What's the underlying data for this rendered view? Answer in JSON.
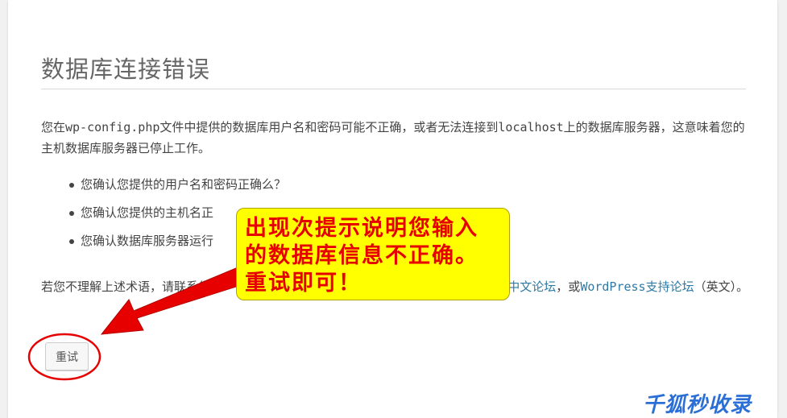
{
  "page": {
    "title": "数据库连接错误",
    "message": "您在wp-config.php文件中提供的数据库用户名和密码可能不正确，或者无法连接到localhost上的数据库服务器，这意味着您的主机数据库服务器已停止工作。",
    "checklist": [
      "您确认您提供的用户名和密码正确么？",
      "您确认您提供的主机名正",
      "您确认数据库服务器运行"
    ],
    "support": {
      "prefix": "若您不理解上述术语，请联系您",
      "link1": "WordPress中文论坛",
      "middle": "，或",
      "link2": "WordPress支持论坛",
      "suffix": "（英文）。"
    },
    "retry_label": "重试"
  },
  "annotation": {
    "callout_text": "出现次提示说明您输入的数据库信息不正确。重试即可！",
    "callout_color": "#ffff00",
    "text_color": "#e60000",
    "arrow_color": "#e60000"
  },
  "watermark": "千狐秒收录"
}
